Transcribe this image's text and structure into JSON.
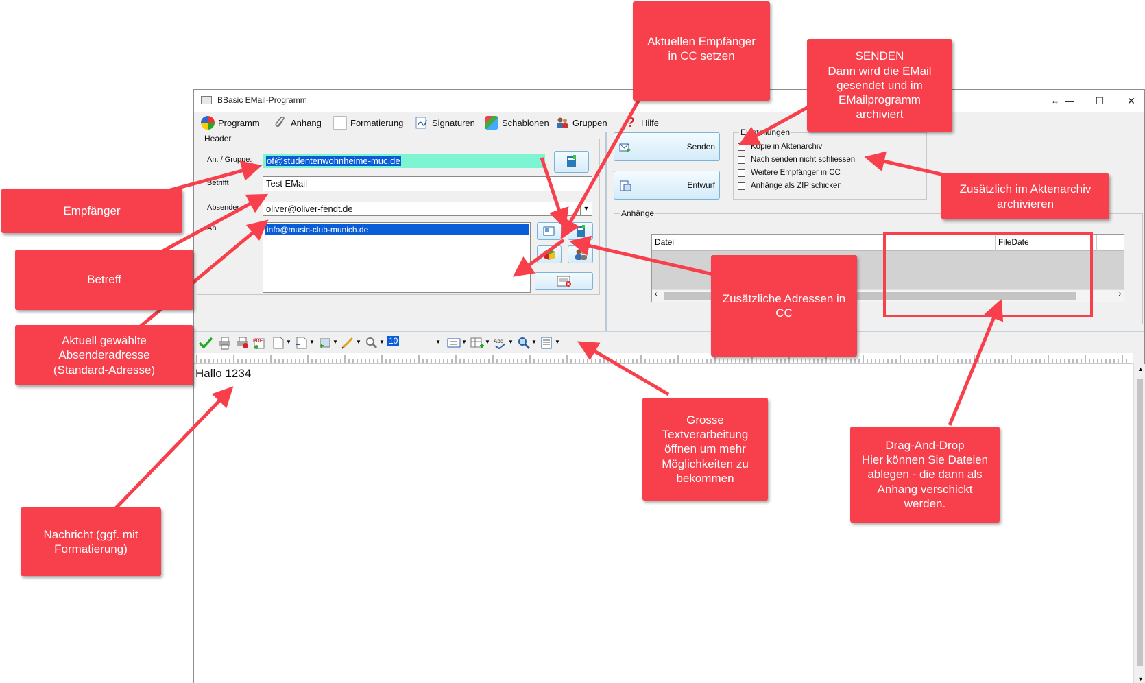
{
  "window": {
    "title": "BBasic EMail-Programm",
    "controls": {
      "resize": "↔",
      "minimize": "—",
      "maximize": "☐",
      "close": "✕"
    }
  },
  "menu": {
    "items": [
      {
        "label": "Programm",
        "icon": "program-icon"
      },
      {
        "label": "Anhang",
        "icon": "paperclip-icon"
      },
      {
        "label": "Formatierung",
        "icon": "format-icon"
      },
      {
        "label": "Signaturen",
        "icon": "signature-icon"
      },
      {
        "label": "Schablonen",
        "icon": "template-icon"
      },
      {
        "label": "Gruppen",
        "icon": "group-icon"
      },
      {
        "label": "Hilfe",
        "icon": "help-icon"
      }
    ]
  },
  "header": {
    "legend": "Header",
    "to_label": "An: / Gruppe:",
    "to_value": "of@studentenwohnheime-muc.de",
    "subject_label": "Betrifft",
    "subject_value": "Test EMail",
    "sender_label": "Absender",
    "sender_value": "oliver@oliver-fendt.de",
    "cc_label": "An",
    "cc_list": [
      "info@music-club-munich.de"
    ]
  },
  "actions": {
    "send_label": "Senden",
    "draft_label": "Entwurf"
  },
  "settings": {
    "legend": "Einstellungen",
    "options": [
      {
        "label": "Kopie in Aktenarchiv",
        "checked": false
      },
      {
        "label": "Nach senden nicht schliessen",
        "checked": false
      },
      {
        "label": "Weitere Empfänger in CC",
        "checked": false
      },
      {
        "label": "Anhänge als ZIP schicken",
        "checked": false
      }
    ]
  },
  "attachments": {
    "legend": "Anhänge",
    "columns": [
      "Datei",
      "FileDate"
    ]
  },
  "editor": {
    "font_size": "10",
    "text": "Hallo 1234"
  },
  "callouts": {
    "empfaenger": "Empfänger",
    "betreff": "Betreff",
    "absender": "Aktuell gewählte\nAbsenderadresse\n(Standard-Adresse)",
    "nachricht": "Nachricht (ggf. mit\nFormatierung)",
    "cc_setzen": "Aktuellen Empfänger\nin CC setzen",
    "senden": "SENDEN\nDann wird die EMail\ngesendet und im\nEMailprogramm\narchiviert",
    "aktenarchiv": "Zusätzlich im Aktenarchiv\narchivieren",
    "zusaetzliche": "Zusätzliche Adressen in\nCC",
    "textverarbeitung": "Grosse\nTextverarbeitung\nöffnen um mehr\nMöglichkeiten zu\nbekommen",
    "dragdrop": "Drag-And-Drop\nHier können Sie Dateien\nablegen - die dann als\nAnhang verschickt\nwerden."
  },
  "colors": {
    "callout": "#f8404c",
    "highlight_field": "#7df5d2",
    "selection": "#0a5dd8",
    "button_border": "#7ab4d9"
  }
}
